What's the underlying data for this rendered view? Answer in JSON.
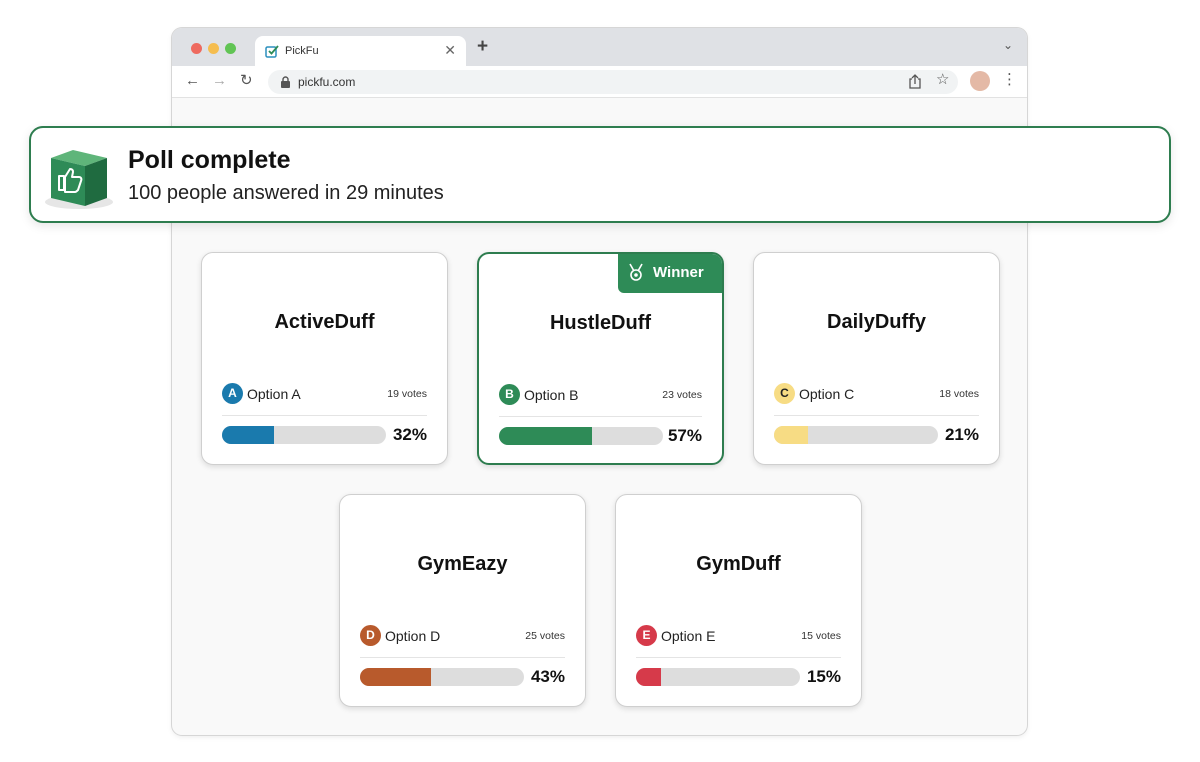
{
  "browser": {
    "tab_title": "PickFu",
    "tab_close": "✕",
    "new_tab": "+",
    "url": "pickfu.com"
  },
  "banner": {
    "title": "Poll complete",
    "subtitle": "100 people answered in 29 minutes"
  },
  "winner_label": "Winner",
  "colors": {
    "accent_green": "#2e7d4f",
    "option_a": "#1a7aad",
    "option_b": "#2e8b57",
    "option_c": "#f7dc84",
    "option_d": "#b85a2c",
    "option_e": "#d63a4a",
    "bar_track": "#dddddd"
  },
  "cards": [
    {
      "name": "ActiveDuff",
      "letter": "A",
      "option": "Option A",
      "votes": "19 votes",
      "percent": "32%",
      "fill": 32,
      "winner": false
    },
    {
      "name": "HustleDuff",
      "letter": "B",
      "option": "Option B",
      "votes": "23 votes",
      "percent": "57%",
      "fill": 57,
      "winner": true
    },
    {
      "name": "DailyDuffy",
      "letter": "C",
      "option": "Option C",
      "votes": "18 votes",
      "percent": "21%",
      "fill": 21,
      "winner": false
    },
    {
      "name": "GymEazy",
      "letter": "D",
      "option": "Option D",
      "votes": "25 votes",
      "percent": "43%",
      "fill": 43,
      "winner": false
    },
    {
      "name": "GymDuff",
      "letter": "E",
      "option": "Option E",
      "votes": "15 votes",
      "percent": "15%",
      "fill": 15,
      "winner": false
    }
  ],
  "icons": {
    "banner": "thumbs-up-cube-icon",
    "winner": "medal-icon",
    "lock": "lock-icon",
    "share": "share-icon",
    "star": "star-icon",
    "more": "more-vertical-icon"
  }
}
